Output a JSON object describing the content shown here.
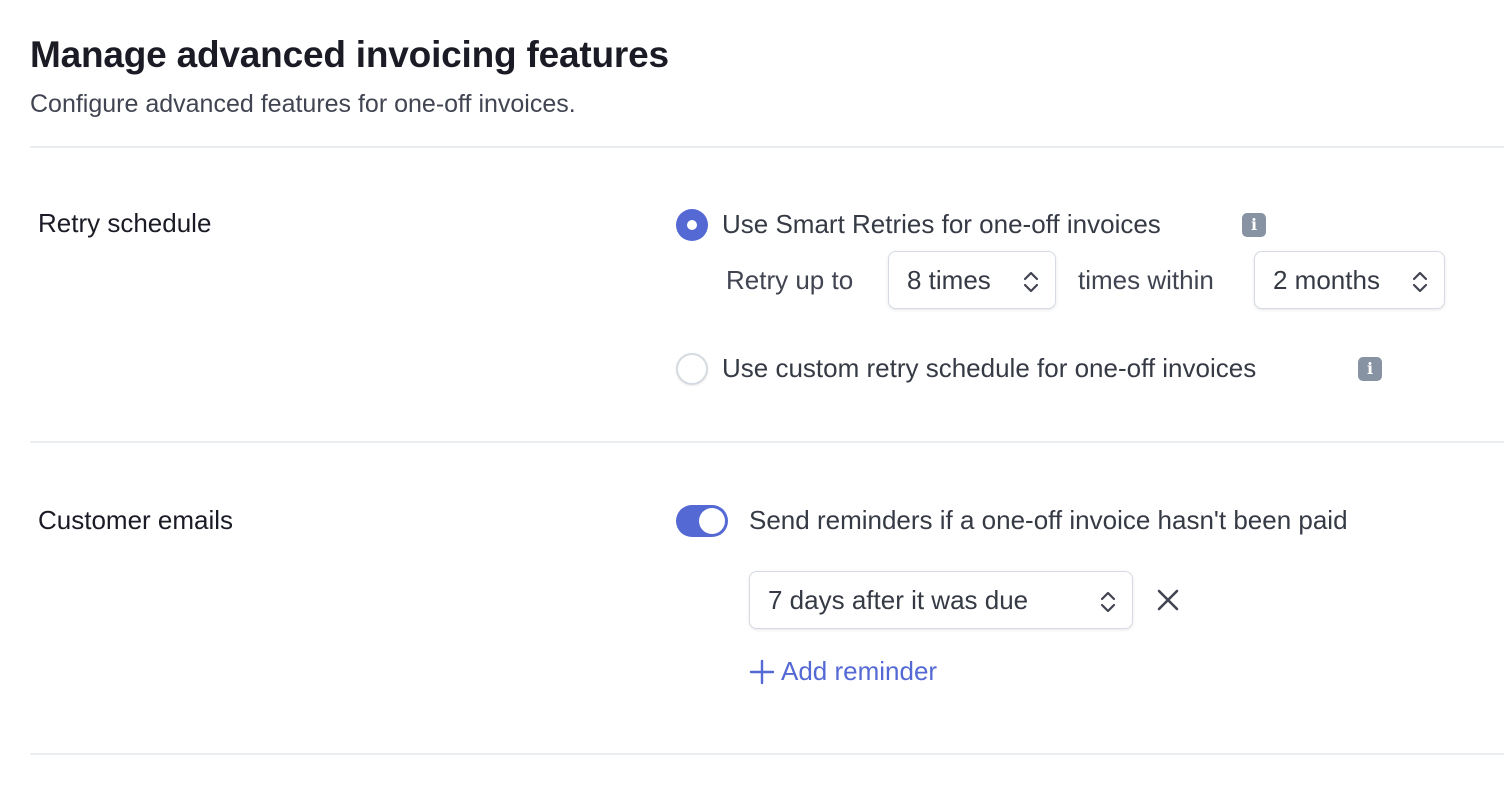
{
  "header": {
    "title": "Manage advanced invoicing features",
    "subtitle": "Configure advanced features for one-off invoices."
  },
  "retry_schedule": {
    "label": "Retry schedule",
    "options": [
      {
        "label": "Use Smart Retries for one-off invoices",
        "selected": true,
        "info_icon": "info-icon"
      },
      {
        "label": "Use custom retry schedule for one-off invoices",
        "selected": false,
        "info_icon": "info-icon"
      }
    ],
    "retry_prefix": "Retry up to",
    "retry_count": {
      "value": "8 times",
      "icon": "chevron-up-down-icon"
    },
    "retry_middle": "times within",
    "retry_window": {
      "value": "2 months",
      "icon": "chevron-up-down-icon"
    }
  },
  "customer_emails": {
    "label": "Customer emails",
    "toggle": {
      "label": "Send reminders if a one-off invoice hasn't been paid",
      "on": true
    },
    "reminders": [
      {
        "value": "7 days after it was due",
        "icon": "chevron-up-down-icon",
        "remove_icon": "close-icon"
      }
    ],
    "add_reminder_label": "Add reminder",
    "add_reminder_icon": "plus-icon"
  },
  "colors": {
    "accent": "#5469d4",
    "text_primary": "#1a1b25",
    "text_secondary": "#414552",
    "divider": "#ebeef1",
    "info_icon_bg": "#8792a2"
  }
}
